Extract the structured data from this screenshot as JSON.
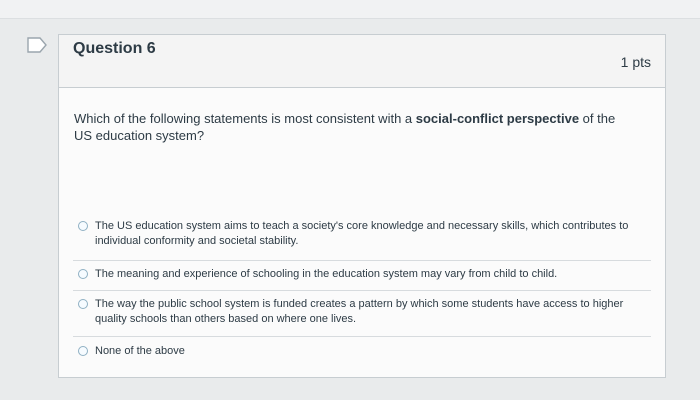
{
  "question": {
    "title": "Question 6",
    "points": "1 pts",
    "text_prefix": "Which of the following statements is most consistent with a ",
    "text_bold": "social-conflict perspective",
    "text_suffix": " of the US education system?"
  },
  "answers": [
    {
      "label": "The US education system aims to teach a society's core knowledge and necessary skills, which contributes to individual conformity and societal stability."
    },
    {
      "label": "The meaning and experience of schooling in the education system may vary from child to child."
    },
    {
      "label": "The way the public school system is funded creates a pattern by which some students have access to higher quality schools than others based on where one lives."
    },
    {
      "label": "None of the above"
    }
  ],
  "icons": {
    "flag": "flag-icon"
  },
  "colors": {
    "background": "#e9ebec",
    "card": "#fbfbfb",
    "header": "#f4f4f4",
    "text": "#2d3b45",
    "radio_border": "#8fb0c3"
  }
}
